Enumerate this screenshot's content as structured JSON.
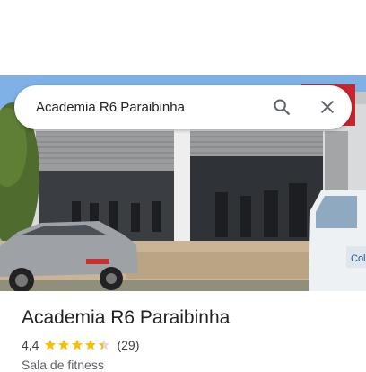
{
  "search": {
    "query": "Academia R6 Paraibinha",
    "search_icon": "search-icon",
    "close_icon": "close-icon"
  },
  "place": {
    "name": "Academia R6 Paraibinha",
    "rating_display": "4,4",
    "rating": 4.4,
    "reviews_display": "(29)",
    "category": "Sala de fitness",
    "star_color": "#fbbc04"
  },
  "photo": {
    "sign_text": "Col"
  }
}
